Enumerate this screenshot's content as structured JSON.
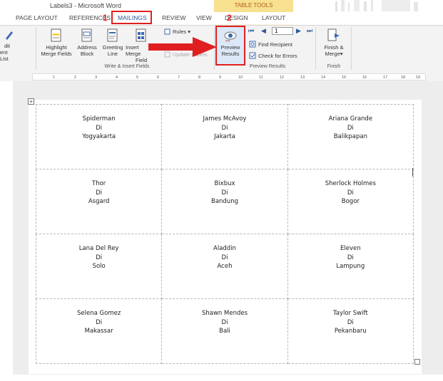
{
  "window": {
    "title": "Labels3 - Microsoft Word",
    "context_tab_group": "TABLE TOOLS"
  },
  "tabs": [
    {
      "label": "PAGE LAYOUT"
    },
    {
      "label": "REFERENCES"
    },
    {
      "label": "MAILINGS"
    },
    {
      "label": "REVIEW"
    },
    {
      "label": "VIEW"
    },
    {
      "label": "DESIGN"
    },
    {
      "label": "LAYOUT"
    }
  ],
  "annotations": {
    "step1": "1",
    "step2": "2"
  },
  "ribbon": {
    "edit_list_line1": "dit",
    "edit_list_line2": "ent List",
    "highlight_line1": "Highlight",
    "highlight_line2": "Merge Fields",
    "address_line1": "Address",
    "address_line2": "Block",
    "greeting_line1": "Greeting",
    "greeting_line2": "Line",
    "insert_line1": "Insert Merge",
    "insert_line2": "Field",
    "rules": "Rules",
    "update_labels": "Update Labels",
    "preview_line1": "Preview",
    "preview_line2": "Results",
    "record_number": "1",
    "find_recipient": "Find Recipient",
    "check_errors": "Check for Errors",
    "finish_line1": "Finish &",
    "finish_line2": "Merge",
    "group_write_insert": "Write & Insert Fields",
    "group_preview": "Preview Results",
    "group_finish": "Finish"
  },
  "ruler": {
    "ticks": [
      "1",
      "2",
      "3",
      "4",
      "5",
      "6",
      "7",
      "8",
      "9",
      "10",
      "11",
      "12",
      "13",
      "14",
      "15",
      "16",
      "17",
      "18",
      "19"
    ]
  },
  "labels": [
    [
      {
        "name": "Spiderman",
        "di": "Di",
        "city": "Yogyakarta"
      },
      {
        "name": "James McAvoy",
        "di": "Di",
        "city": "Jakarta"
      },
      {
        "name": "Ariana Grande",
        "di": "Di",
        "city": "Balikpapan"
      }
    ],
    [
      {
        "name": "Thor",
        "di": "Di",
        "city": "Asgard"
      },
      {
        "name": "Bixbux",
        "di": "Di",
        "city": "Bandung"
      },
      {
        "name": "Sherlock Holmes",
        "di": "Di",
        "city": "Bogor"
      }
    ],
    [
      {
        "name": "Lana Del Rey",
        "di": "Di",
        "city": "Solo"
      },
      {
        "name": "Aladdin",
        "di": "Di",
        "city": "Aceh"
      },
      {
        "name": "Eleven",
        "di": "Di",
        "city": "Lampung"
      }
    ],
    [
      {
        "name": "Selena Gomez",
        "di": "Di",
        "city": "Makassar"
      },
      {
        "name": "Shawn Mendes",
        "di": "Di",
        "city": "Bali"
      },
      {
        "name": "Taylor Swift",
        "di": "Di",
        "city": "Pekanbaru"
      }
    ]
  ]
}
